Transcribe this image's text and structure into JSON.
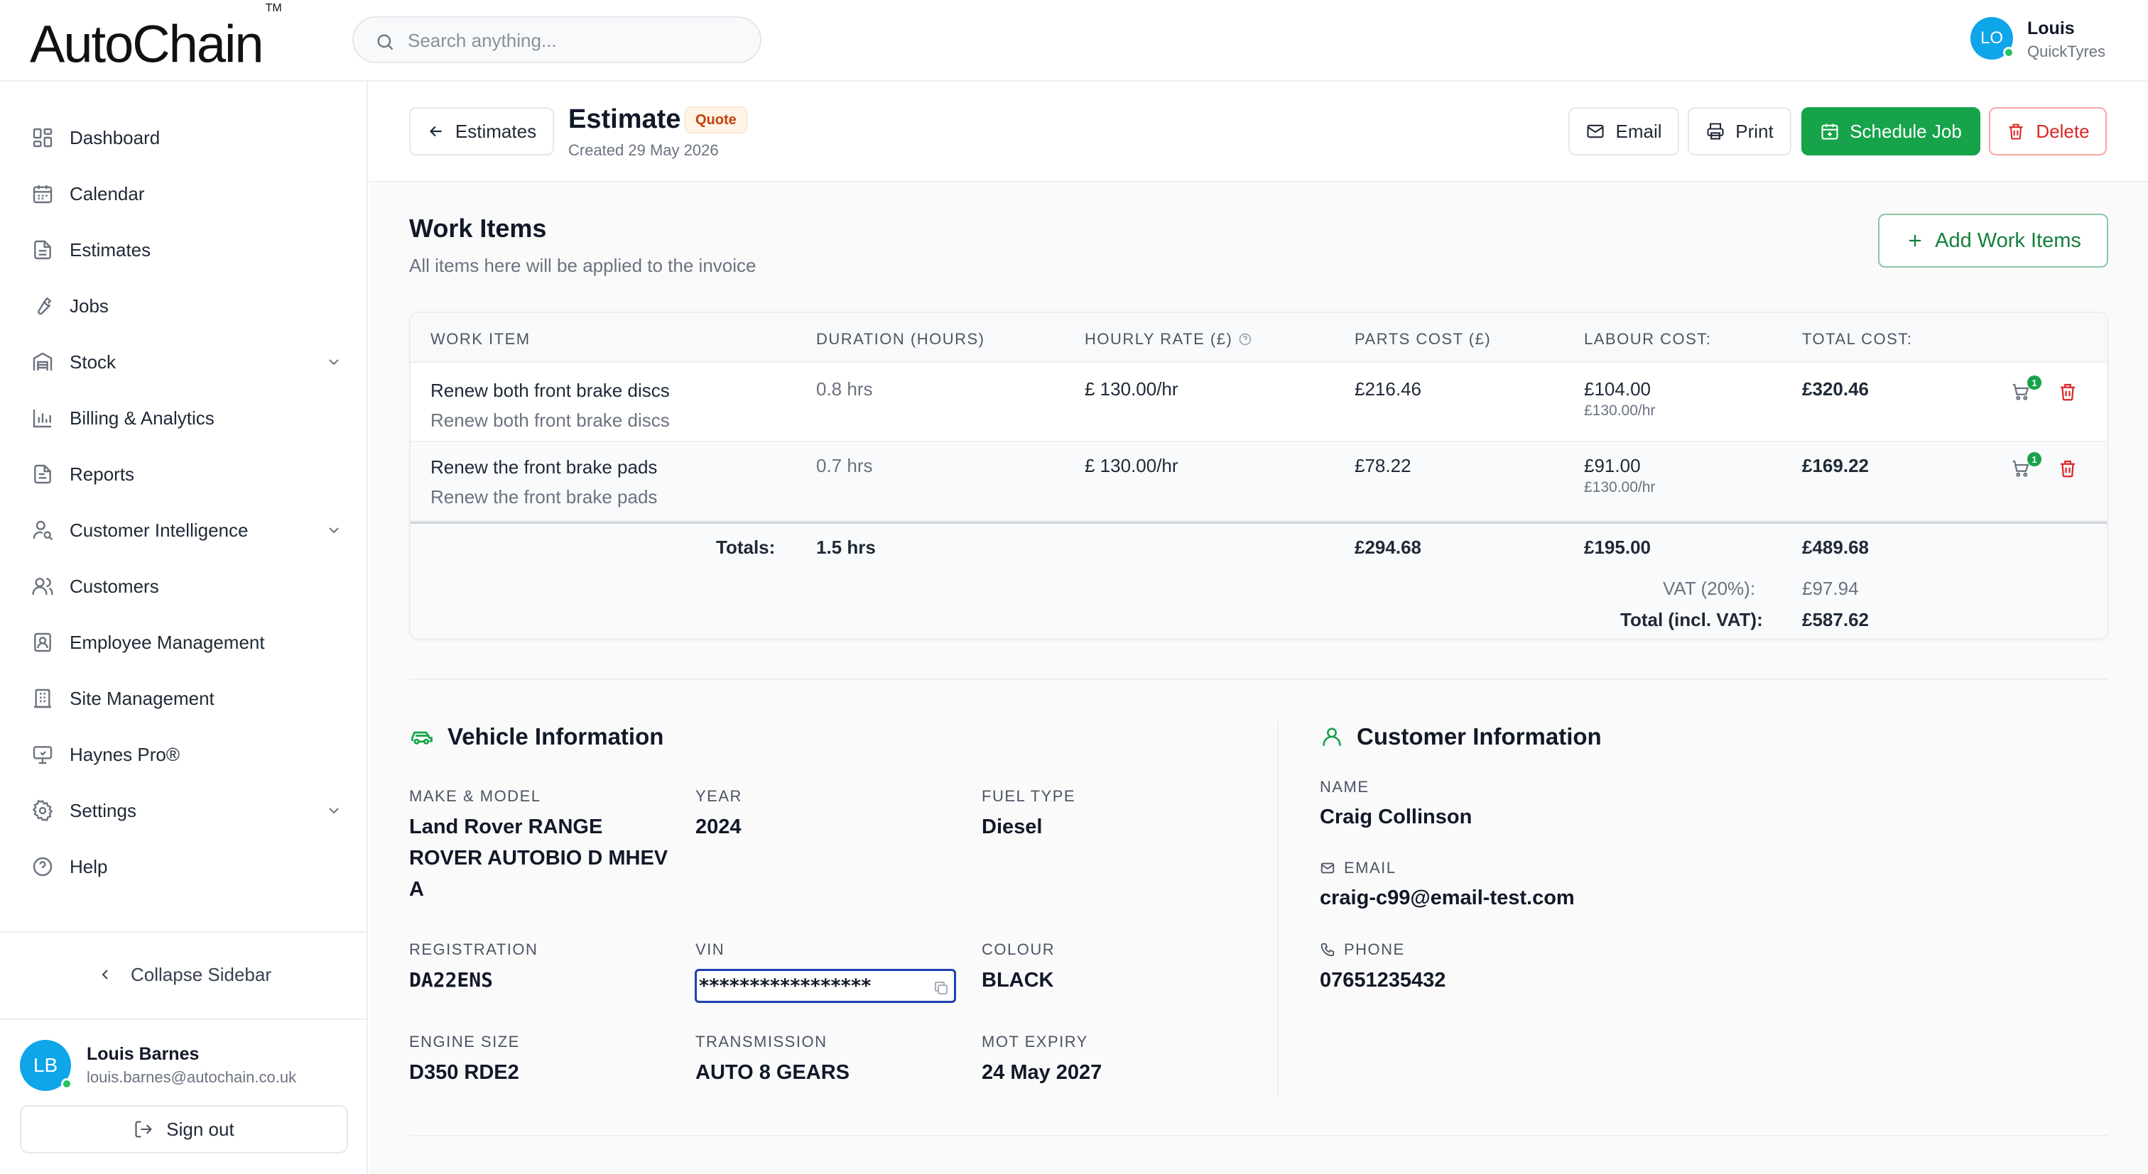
{
  "app": {
    "logo_main": "AutoChain",
    "logo_tm": "TM"
  },
  "search": {
    "placeholder": "Search anything..."
  },
  "top_user": {
    "initials": "LO",
    "name": "Louis",
    "org": "QuickTyres"
  },
  "sidebar": {
    "items": [
      {
        "label": "Dashboard",
        "icon": "grid-icon"
      },
      {
        "label": "Calendar",
        "icon": "calendar-icon"
      },
      {
        "label": "Estimates",
        "icon": "document-icon"
      },
      {
        "label": "Jobs",
        "icon": "wrench-icon"
      },
      {
        "label": "Stock",
        "icon": "warehouse-icon",
        "expandable": true
      },
      {
        "label": "Billing & Analytics",
        "icon": "bar-chart-icon"
      },
      {
        "label": "Reports",
        "icon": "report-icon"
      },
      {
        "label": "Customer Intelligence",
        "icon": "user-search-icon",
        "expandable": true
      },
      {
        "label": "Customers",
        "icon": "users-icon"
      },
      {
        "label": "Employee Management",
        "icon": "id-badge-icon"
      },
      {
        "label": "Site Management",
        "icon": "building-icon"
      },
      {
        "label": "Haynes Pro®",
        "icon": "monitor-icon"
      },
      {
        "label": "Settings",
        "icon": "gear-icon",
        "expandable": true
      },
      {
        "label": "Help",
        "icon": "help-icon"
      }
    ],
    "collapse_label": "Collapse Sidebar",
    "user": {
      "initials": "LB",
      "name": "Louis Barnes",
      "email": "louis.barnes@autochain.co.uk"
    },
    "signout_label": "Sign out"
  },
  "header": {
    "back_label": "Estimates",
    "title": "Estimate",
    "badge": "Quote",
    "created": "Created 29 May 2026",
    "email_label": "Email",
    "print_label": "Print",
    "schedule_label": "Schedule Job",
    "delete_label": "Delete"
  },
  "work_items": {
    "title": "Work Items",
    "subtitle": "All items here will be applied to the invoice",
    "add_label": "Add Work Items",
    "columns": [
      "WORK ITEM",
      "DURATION (HOURS)",
      "HOURLY RATE (£)",
      "PARTS COST (£)",
      "LABOUR COST:",
      "TOTAL COST:"
    ],
    "rows": [
      {
        "name": "Renew both front brake discs",
        "description": "Renew both front brake discs",
        "duration": "0.8 hrs",
        "rate": "£ 130.00/hr",
        "parts": "£216.46",
        "labour": "£104.00",
        "labour_rate": "£130.00/hr",
        "total": "£320.46",
        "cart_count": "1"
      },
      {
        "name": "Renew the front brake pads",
        "description": "Renew the front brake pads",
        "duration": "0.7 hrs",
        "rate": "£ 130.00/hr",
        "parts": "£78.22",
        "labour": "£91.00",
        "labour_rate": "£130.00/hr",
        "total": "£169.22",
        "cart_count": "1"
      }
    ],
    "totals": {
      "label": "Totals:",
      "duration": "1.5 hrs",
      "parts": "£294.68",
      "labour": "£195.00",
      "total": "£489.68",
      "vat_label": "VAT (20%):",
      "vat": "£97.94",
      "grand_label": "Total (incl. VAT):",
      "grand": "£587.62"
    }
  },
  "vehicle": {
    "title": "Vehicle Information",
    "make_label": "MAKE & MODEL",
    "make_line1": "Land Rover RANGE",
    "make_line2": "ROVER AUTOBIO D MHEV",
    "make_line3": "A",
    "year_label": "YEAR",
    "year": "2024",
    "fuel_label": "FUEL TYPE",
    "fuel": "Diesel",
    "reg_label": "REGISTRATION",
    "reg": "DA22ENS",
    "vin_label": "VIN",
    "vin": "*****************",
    "colour_label": "COLOUR",
    "colour": "BLACK",
    "engine_label": "ENGINE SIZE",
    "engine": "D350 RDE2",
    "trans_label": "TRANSMISSION",
    "trans": "AUTO 8 GEARS",
    "mot_label": "MOT EXPIRY",
    "mot": "24 May 2027"
  },
  "customer": {
    "title": "Customer Information",
    "name_label": "NAME",
    "name": "Craig Collinson",
    "email_label": "EMAIL",
    "email": "craig-c99@email-test.com",
    "phone_label": "PHONE",
    "phone": "07651235432"
  },
  "colors": {
    "primary_green": "#16a34a",
    "danger_red": "#dc2626",
    "avatar_blue": "#0ea5e9",
    "badge_orange": "#c2410c"
  }
}
